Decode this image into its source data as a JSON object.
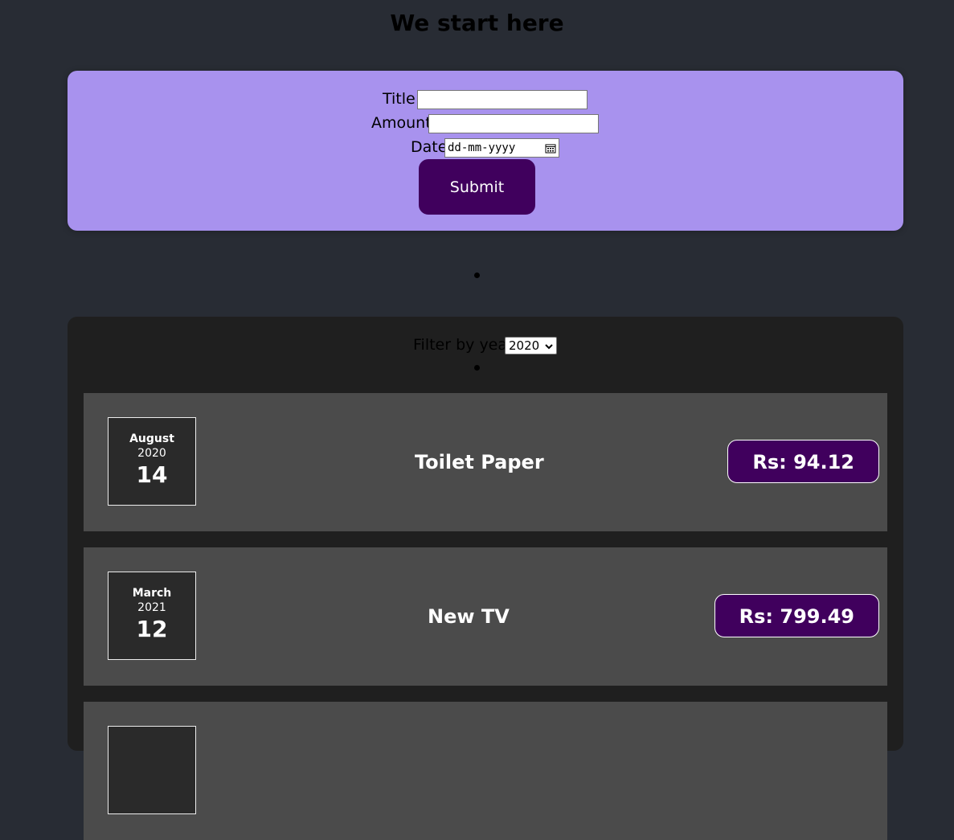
{
  "header": {
    "title": "We start here"
  },
  "form": {
    "title_label": "Title",
    "title_value": "",
    "amount_label": "Amount",
    "amount_value": "",
    "date_label": "Date",
    "date_placeholder": "dd-mm-yyyy",
    "submit_label": "Submit"
  },
  "filter": {
    "label": "Filter by year",
    "selected": "2020"
  },
  "expenses": [
    {
      "month": "August",
      "year": "2020",
      "day": "14",
      "title": "Toilet Paper",
      "amount": "Rs: 94.12"
    },
    {
      "month": "March",
      "year": "2021",
      "day": "12",
      "title": "New TV",
      "amount": "Rs: 799.49"
    },
    {
      "month": "",
      "year": "",
      "day": "",
      "title": "",
      "amount": ""
    }
  ],
  "colors": {
    "background": "#282c34",
    "form_card": "#a892ee",
    "accent": "#40005d",
    "list_card": "#1f1f1f",
    "item": "#4b4b4b"
  }
}
